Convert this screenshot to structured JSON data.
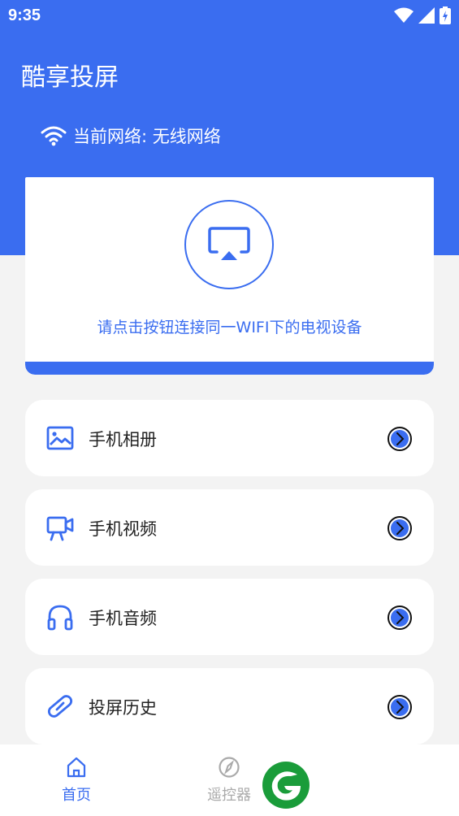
{
  "status_bar": {
    "time": "9:35"
  },
  "header": {
    "title": "酷享投屏",
    "network_text": "当前网络: 无线网络"
  },
  "connect_card": {
    "hint": "请点击按钮连接同一WIFI下的电视设备"
  },
  "menu": [
    {
      "label": "手机相册",
      "icon": "photo-icon"
    },
    {
      "label": "手机视频",
      "icon": "video-camera-icon"
    },
    {
      "label": "手机音频",
      "icon": "headphones-icon"
    },
    {
      "label": "投屏历史",
      "icon": "link-icon"
    }
  ],
  "tabbar": {
    "home_label": "首页",
    "remote_label": "遥控器"
  },
  "colors": {
    "primary": "#3a6df0",
    "inactive": "#aaaaaa",
    "logo_green": "#1a9c3a"
  }
}
